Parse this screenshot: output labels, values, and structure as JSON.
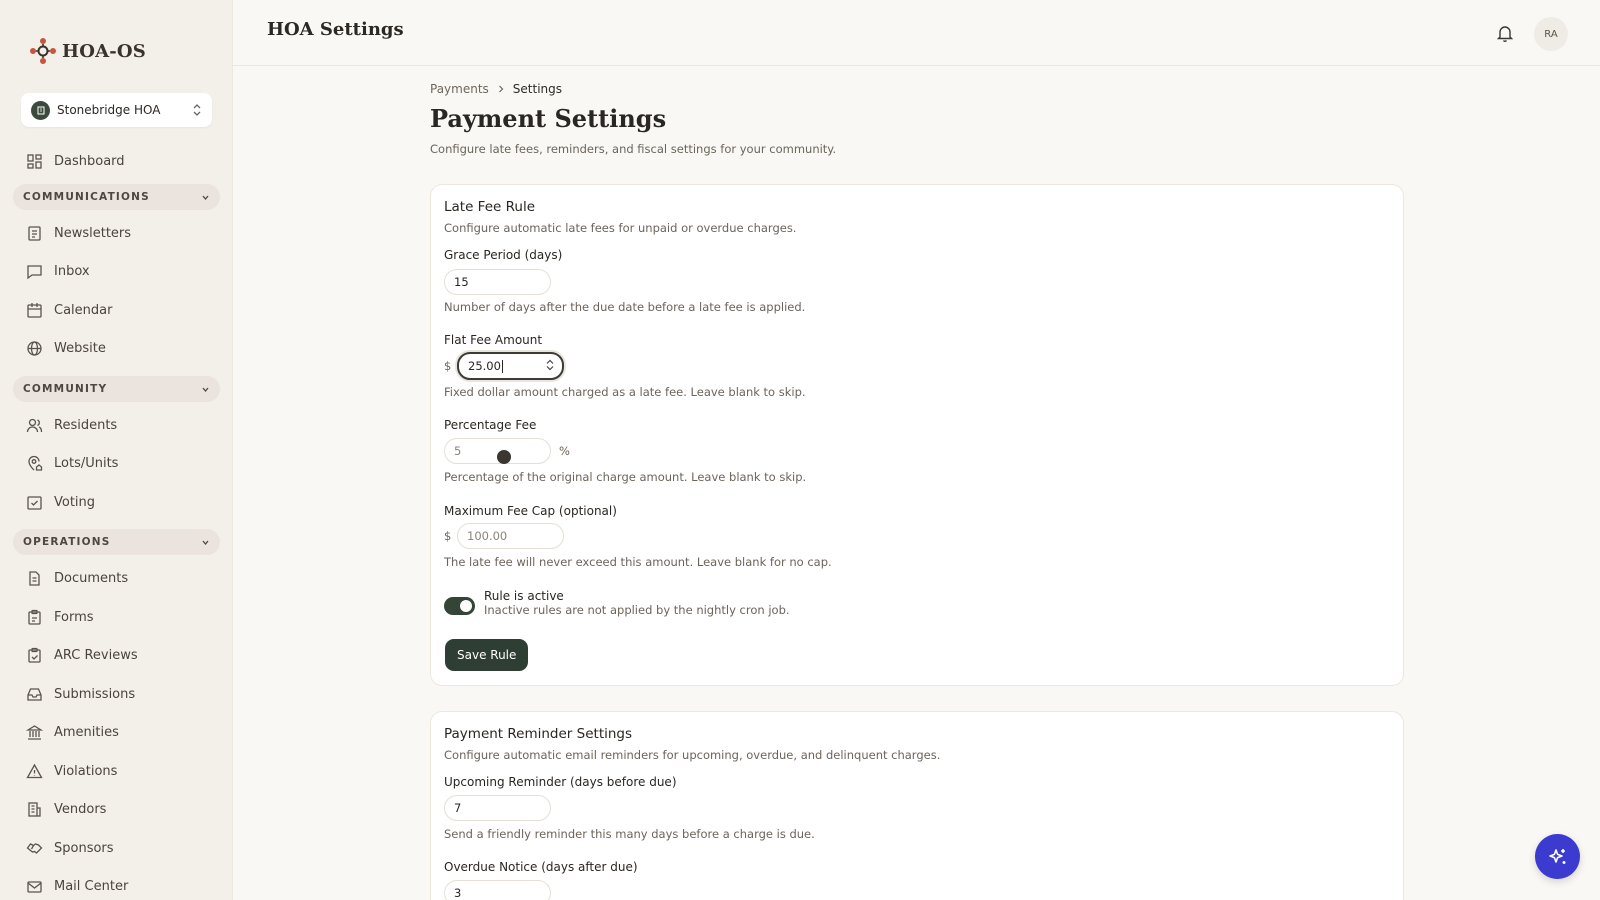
{
  "app": {
    "name": "HOA-OS"
  },
  "org_switcher": {
    "name": "Stonebridge HOA"
  },
  "header": {
    "title": "HOA Settings",
    "user_initials": "RA"
  },
  "sidebar": {
    "dashboard": "Dashboard",
    "sections": [
      {
        "label": "COMMUNICATIONS",
        "items": [
          "Newsletters",
          "Inbox",
          "Calendar",
          "Website"
        ]
      },
      {
        "label": "COMMUNITY",
        "items": [
          "Residents",
          "Lots/Units",
          "Voting"
        ]
      },
      {
        "label": "OPERATIONS",
        "items": [
          "Documents",
          "Forms",
          "ARC Reviews",
          "Submissions",
          "Amenities",
          "Violations",
          "Vendors",
          "Sponsors",
          "Mail Center"
        ]
      }
    ]
  },
  "breadcrumb": {
    "parent": "Payments",
    "current": "Settings"
  },
  "page": {
    "title": "Payment Settings",
    "subtitle": "Configure late fees, reminders, and fiscal settings for your community."
  },
  "late_fee": {
    "title": "Late Fee Rule",
    "description": "Configure automatic late fees for unpaid or overdue charges.",
    "grace": {
      "label": "Grace Period (days)",
      "value": "15",
      "hint": "Number of days after the due date before a late fee is applied."
    },
    "flat": {
      "label": "Flat Fee Amount",
      "prefix": "$",
      "value": "25.00",
      "hint": "Fixed dollar amount charged as a late fee. Leave blank to skip."
    },
    "percent": {
      "label": "Percentage Fee",
      "placeholder": "5",
      "suffix": "%",
      "hint": "Percentage of the original charge amount. Leave blank to skip."
    },
    "cap": {
      "label": "Maximum Fee Cap (optional)",
      "prefix": "$",
      "placeholder": "100.00",
      "hint": "The late fee will never exceed this amount. Leave blank for no cap."
    },
    "active": {
      "label": "Rule is active",
      "hint": "Inactive rules are not applied by the nightly cron job.",
      "on": true
    },
    "save_label": "Save Rule"
  },
  "reminders": {
    "title": "Payment Reminder Settings",
    "description": "Configure automatic email reminders for upcoming, overdue, and delinquent charges.",
    "upcoming": {
      "label": "Upcoming Reminder (days before due)",
      "value": "7",
      "hint": "Send a friendly reminder this many days before a charge is due."
    },
    "overdue": {
      "label": "Overdue Notice (days after due)",
      "value": "3"
    }
  },
  "colors": {
    "accent_dark": "#2f3e33",
    "fab": "#3b3bcf",
    "logo": "#c8553d"
  }
}
